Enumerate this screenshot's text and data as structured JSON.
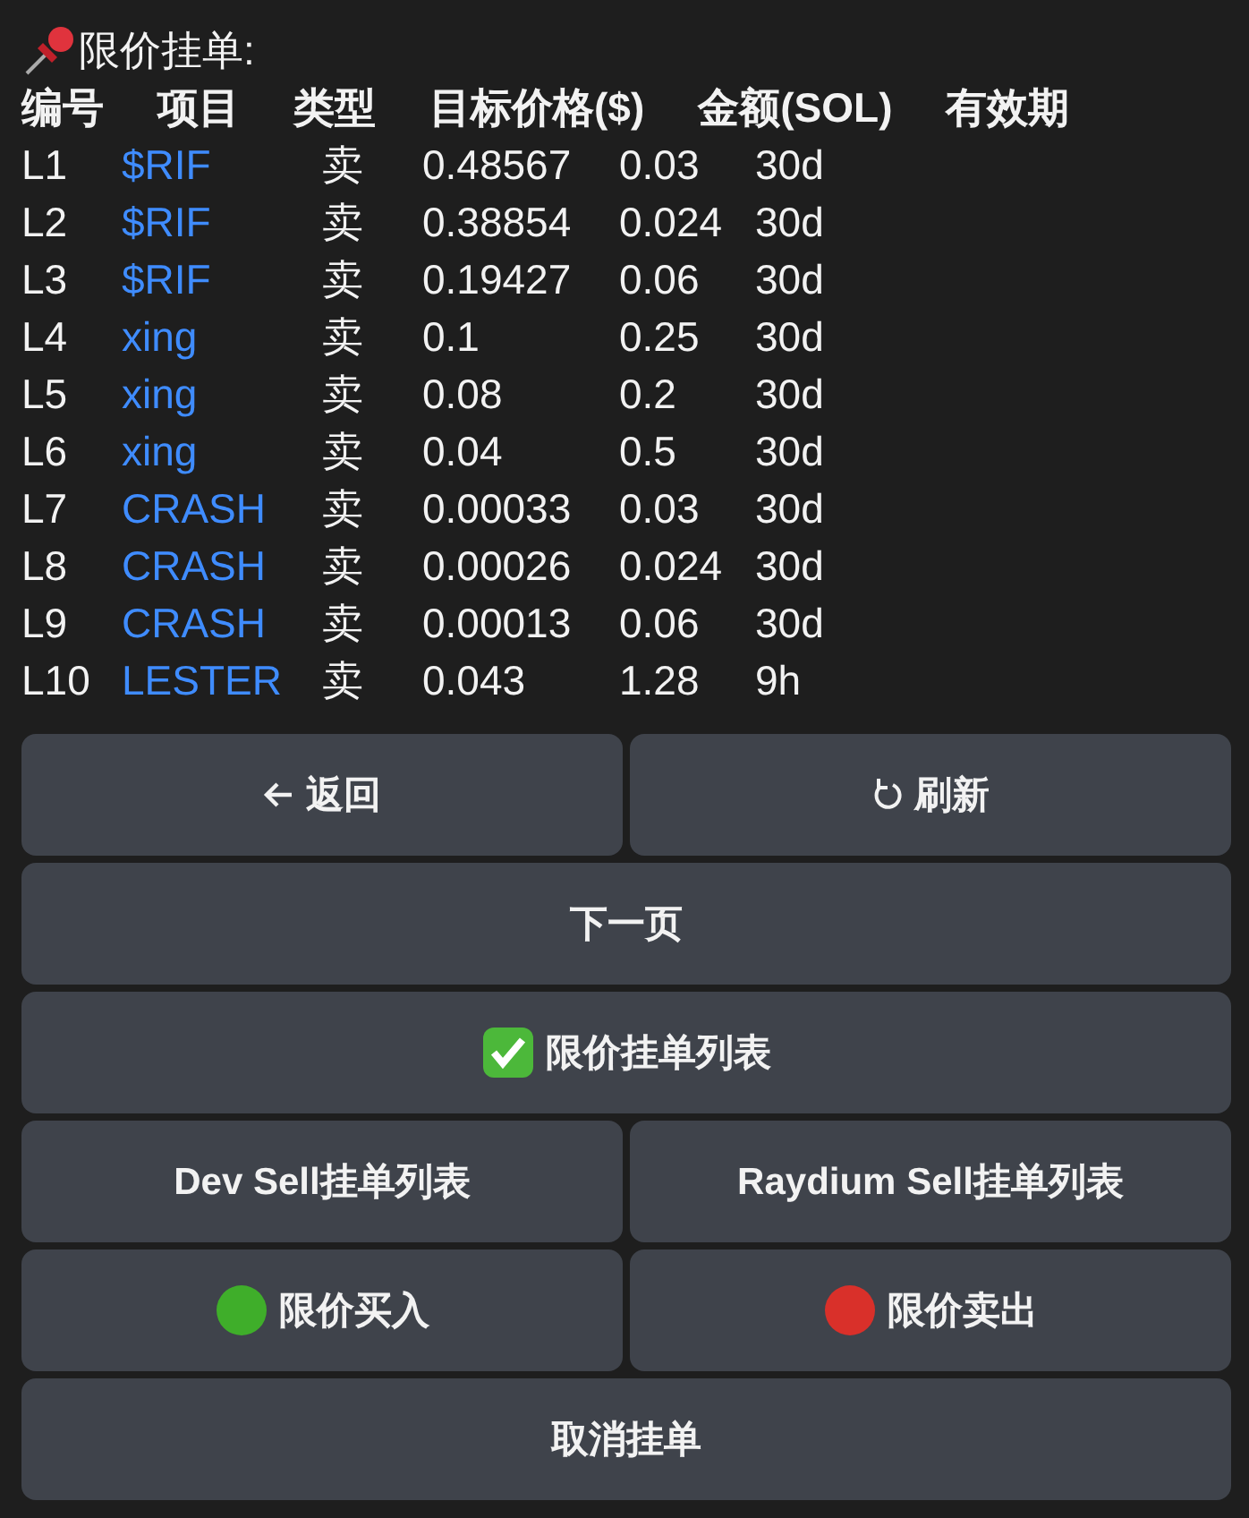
{
  "title": "限价挂单:",
  "columns": [
    "编号",
    "项目",
    "类型",
    "目标价格($)",
    "金额(SOL)",
    "有效期"
  ],
  "rows": [
    {
      "id": "L1",
      "token": "$RIF",
      "type": "卖",
      "price": "0.48567",
      "amount": "0.03",
      "expiry": "30d"
    },
    {
      "id": "L2",
      "token": "$RIF",
      "type": "卖",
      "price": "0.38854",
      "amount": "0.024",
      "expiry": "30d"
    },
    {
      "id": "L3",
      "token": "$RIF",
      "type": "卖",
      "price": "0.19427",
      "amount": "0.06",
      "expiry": "30d"
    },
    {
      "id": "L4",
      "token": "xing",
      "type": "卖",
      "price": "0.1",
      "amount": "0.25",
      "expiry": "30d"
    },
    {
      "id": "L5",
      "token": "xing",
      "type": "卖",
      "price": "0.08",
      "amount": "0.2",
      "expiry": "30d"
    },
    {
      "id": "L6",
      "token": "xing",
      "type": "卖",
      "price": "0.04",
      "amount": "0.5",
      "expiry": "30d"
    },
    {
      "id": "L7",
      "token": "CRASH",
      "type": "卖",
      "price": "0.00033",
      "amount": "0.03",
      "expiry": "30d"
    },
    {
      "id": "L8",
      "token": "CRASH",
      "type": "卖",
      "price": "0.00026",
      "amount": "0.024",
      "expiry": "30d"
    },
    {
      "id": "L9",
      "token": "CRASH",
      "type": "卖",
      "price": "0.00013",
      "amount": "0.06",
      "expiry": "30d"
    },
    {
      "id": "L10",
      "token": "LESTER",
      "type": "卖",
      "price": "0.043",
      "amount": "1.28",
      "expiry": "9h"
    }
  ],
  "keyboard": [
    [
      {
        "label": "返回",
        "kind": "back"
      },
      {
        "label": "刷新",
        "kind": "refresh"
      }
    ],
    [
      {
        "label": "下一页",
        "kind": "plain"
      }
    ],
    [
      {
        "label": "限价挂单列表",
        "kind": "check"
      }
    ],
    [
      {
        "label": "Dev Sell挂单列表",
        "kind": "plain"
      },
      {
        "label": "Raydium Sell挂单列表",
        "kind": "plain"
      }
    ],
    [
      {
        "label": "限价买入",
        "kind": "buy"
      },
      {
        "label": "限价卖出",
        "kind": "sell"
      }
    ],
    [
      {
        "label": "取消挂单",
        "kind": "plain"
      }
    ]
  ]
}
